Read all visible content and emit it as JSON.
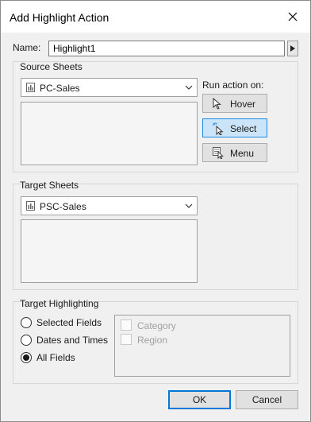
{
  "dialog": {
    "title": "Add Highlight Action",
    "close_icon": "close-icon"
  },
  "name": {
    "label": "Name:",
    "value": "Highlight1",
    "menu_icon": "triangle-right-icon"
  },
  "source_sheets": {
    "label": "Source Sheets",
    "selected": "PC-Sales",
    "sheet_icon": "worksheet-chart-icon",
    "dropdown_icon": "chevron-down-icon"
  },
  "run_action": {
    "label": "Run action on:",
    "buttons": [
      {
        "label": "Hover",
        "icon": "cursor-arrow-icon",
        "active": false
      },
      {
        "label": "Select",
        "icon": "select-cursor-icon",
        "active": true
      },
      {
        "label": "Menu",
        "icon": "menu-icon",
        "active": false
      }
    ]
  },
  "target_sheets": {
    "label": "Target Sheets",
    "selected": "PSC-Sales",
    "sheet_icon": "worksheet-chart-icon",
    "dropdown_icon": "chevron-down-icon"
  },
  "target_highlighting": {
    "label": "Target Highlighting",
    "options": [
      {
        "label": "Selected Fields",
        "checked": false
      },
      {
        "label": "Dates and Times",
        "checked": false
      },
      {
        "label": "All Fields",
        "checked": true
      }
    ],
    "fields": [
      {
        "label": "Category",
        "checked": false,
        "enabled": false
      },
      {
        "label": "Region",
        "checked": false,
        "enabled": false
      }
    ]
  },
  "footer": {
    "ok_label": "OK",
    "cancel_label": "Cancel"
  },
  "colors": {
    "active_button_bg": "#cce4f7",
    "active_button_border": "#1e88e5",
    "primary_border": "#0078d7"
  }
}
